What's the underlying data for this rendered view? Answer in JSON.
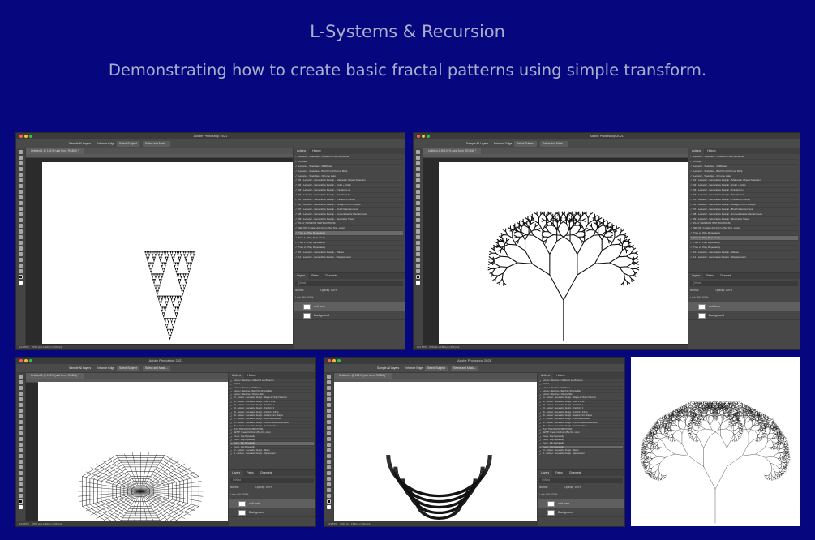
{
  "header": {
    "title": "L-Systems & Recursion",
    "subtitle": "Demonstrating how to create basic fractal patterns using simple transform."
  },
  "colors": {
    "background": "#06067e",
    "header_text": "#a9aecb",
    "ps_chrome": "#535353",
    "canvas": "#ffffff"
  },
  "photoshop": {
    "app_title": "Adobe Photoshop 2021",
    "doc_tab": "Untitled-1 @ 101% (unit form, RGB/8) *",
    "options": {
      "sample_all_layers": "Sample All Layers",
      "enhance_edge": "Enhance Edge",
      "select_subject": "Select Subject",
      "select_and_mask": "Select and Mask..."
    },
    "status": "101.67%",
    "doc_size": "2700 px x 1800 px (300 ppi)",
    "panel_tabs": [
      "Actions",
      "History"
    ],
    "actions": [
      "Lettuce! - Sketches - Untitled for Lee Bontecou",
      "Untitled",
      "Lettuce! - Sketches - Wildflower",
      "Lettuce! - Sketches - Bad Print (Chrome Bari)",
      "Lettuce! - Sketches - Chrome Halo",
      "01 - Lettuce! - Generative Design - Shapes in Object Selection",
      "02 - Lettuce! - Generative Design - Color + Grids",
      "03 - Lettuce! - Generative Design - Transform a",
      "04 - Lettuce! - Generative Design - Transform b",
      "05 - Lettuce! - Generative Design - Transform Infinity",
      "06 - Lettuce! - Generative Design - Designs From Shapes",
      "07 - Lettuce! - Generative Design - Brush Randomness",
      "08 - Lettuce! - Generative Design - Content Aware Randomness",
      "09 - Lettuce! - Generative Design - Recursive Trees",
      "PLAY THIS FOR INSTRUCTIONS",
      "SETUP: Create Unit Form (Play first, once)",
      "Tree a - Play Repeatedly",
      "Tree b - Play Repeatedly",
      "Tree c - Play Repeatedly",
      "Tree d - Play Repeatedly",
      "10 - Lettuce! - Generative Design - Waves",
      "11 - Lettuce! - Generative Design - Displacement"
    ],
    "layers_tabs": [
      "Layers",
      "Paths",
      "Channels"
    ],
    "layers_search": "Q Kind",
    "blend_mode": "Normal",
    "opacity": "Opacity: 100%",
    "lock_fill": "Lock:   Fill: 100%",
    "layers": [
      "unit form",
      "Background"
    ]
  },
  "screenshots": [
    {
      "pattern": "sierpinski-triangle",
      "selected_action": 16
    },
    {
      "pattern": "fractal-tree",
      "selected_action": 17
    },
    {
      "pattern": "octagon-lattice",
      "selected_action": 18
    },
    {
      "pattern": "fractal-fan",
      "selected_action": 19
    }
  ],
  "final": {
    "pattern": "fractal-tree-fine"
  }
}
